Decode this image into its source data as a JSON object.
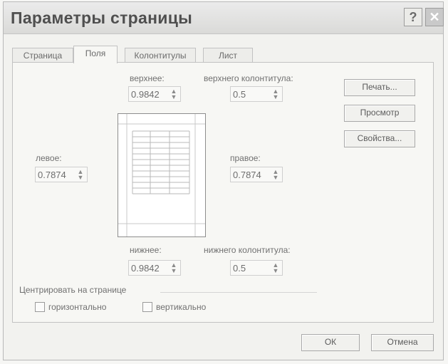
{
  "dialog": {
    "title": "Параметры страницы",
    "help_glyph": "?",
    "close_glyph": "✕"
  },
  "tabs": [
    {
      "label": "Страница"
    },
    {
      "label": "Поля"
    },
    {
      "label": "Колонтитулы"
    },
    {
      "label": "Лист"
    }
  ],
  "active_tab": "Поля",
  "margins": {
    "top": {
      "label": "верхнее:",
      "value": "0.9842"
    },
    "header": {
      "label": "верхнего колонтитула:",
      "value": "0.5"
    },
    "left": {
      "label": "левое:",
      "value": "0.7874"
    },
    "right": {
      "label": "правое:",
      "value": "0.7874"
    },
    "bottom": {
      "label": "нижнее:",
      "value": "0.9842"
    },
    "footer": {
      "label": "нижнего колонтитула:",
      "value": "0.5"
    }
  },
  "side_buttons": {
    "print": "Печать...",
    "preview": "Просмотр",
    "properties": "Свойства..."
  },
  "center": {
    "group_label": "Центрировать на странице",
    "horizontal": "горизонтально",
    "vertical": "вертикально",
    "horizontal_checked": false,
    "vertical_checked": false
  },
  "footer_buttons": {
    "ok": "ОК",
    "cancel": "Отмена"
  }
}
